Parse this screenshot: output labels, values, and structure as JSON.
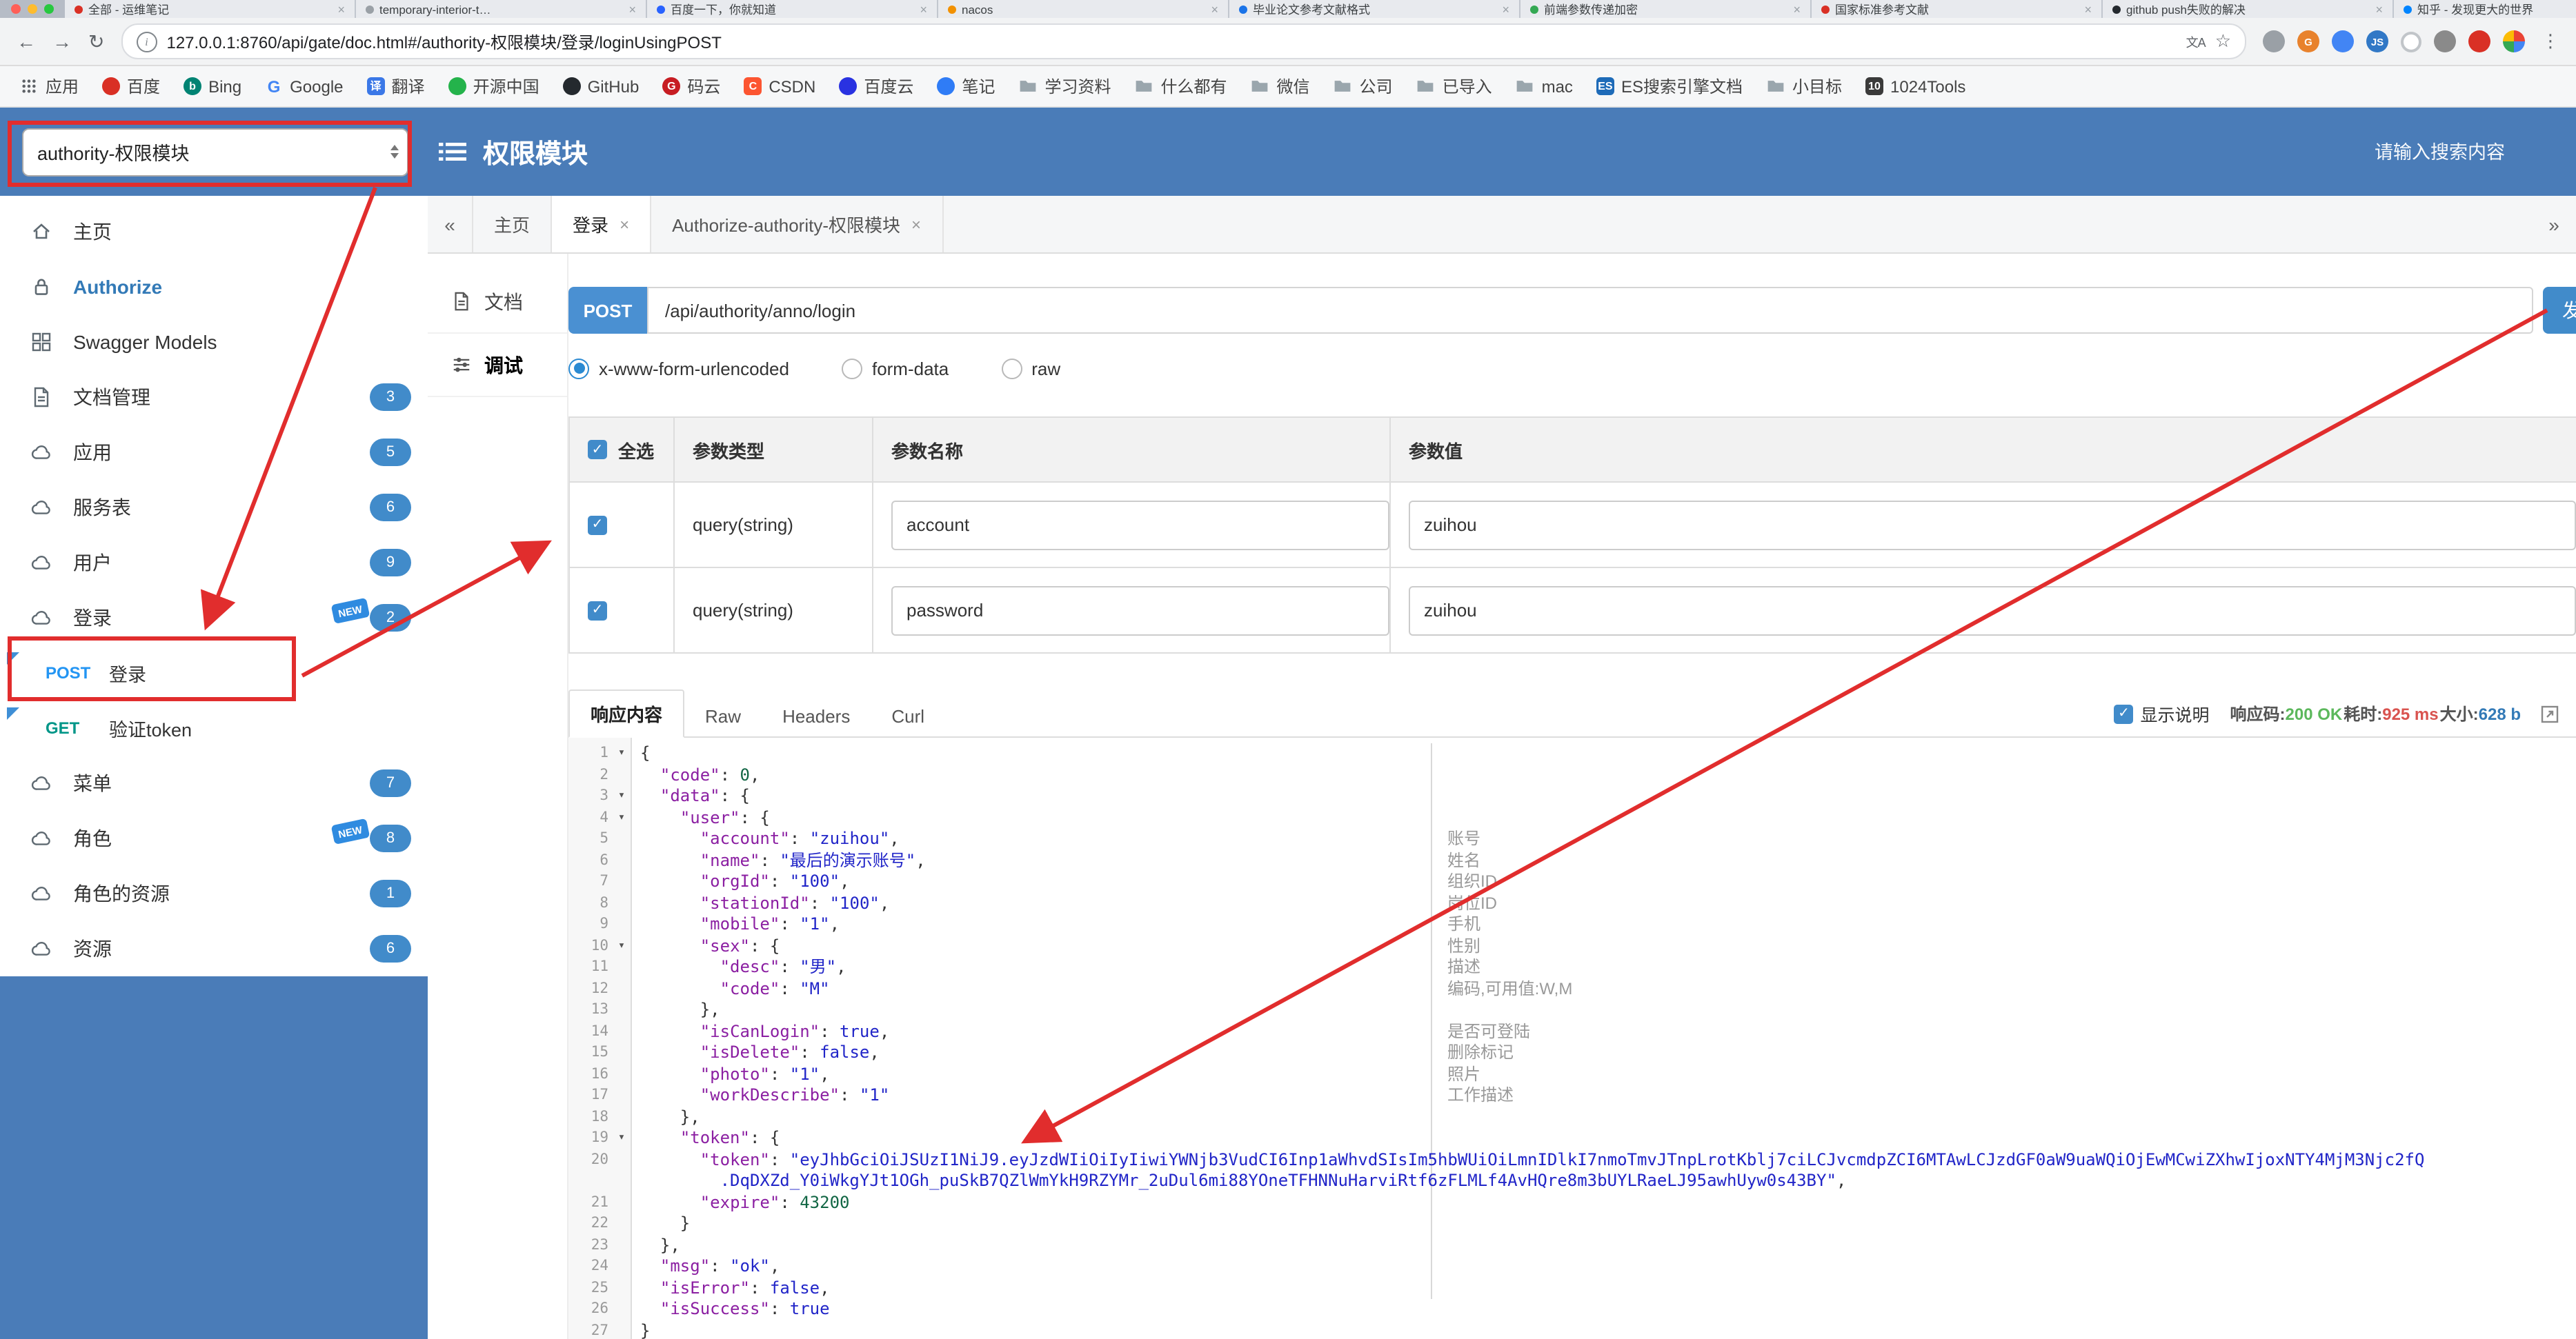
{
  "browser": {
    "close_glyph": "×",
    "star_glyph": "☆",
    "menu_glyph": "⋮",
    "translate_label": "文A",
    "nav": {
      "back": "←",
      "forward": "→",
      "reload": "↻"
    },
    "url": "127.0.0.1:8760/api/gate/doc.html#/authority-权限模块/登录/loginUsingPOST",
    "tabs": [
      {
        "title": "全部 - 运维笔记",
        "color": "#d93025"
      },
      {
        "title": "temporary-interior-t…",
        "color": "#9aa0a6"
      },
      {
        "title": "百度一下，你就知道",
        "color": "#2962ff"
      },
      {
        "title": "nacos",
        "color": "#f29100"
      },
      {
        "title": "毕业论文参考文献格式",
        "color": "#1a73e8"
      },
      {
        "title": "前端参数传递加密",
        "color": "#34a853"
      },
      {
        "title": "国家标准参考文献",
        "color": "#d93025"
      },
      {
        "title": "github push失败的解决",
        "color": "#24292e"
      },
      {
        "title": "知乎 - 发现更大的世界",
        "color": "#0084ff"
      }
    ],
    "ext_icons": [
      {
        "color": "#9aa0a6"
      },
      {
        "color": "#e8822d",
        "label": "G"
      },
      {
        "color": "#4285f4"
      },
      {
        "color": "#3178c6",
        "label": "JS"
      },
      {
        "color": "#f1f1f1",
        "ring": true
      },
      {
        "color": "#8a8a8a"
      },
      {
        "color": "#d93025"
      },
      {
        "color": "pinwheel"
      }
    ],
    "bookmarks": [
      {
        "label": "应用",
        "type": "grid"
      },
      {
        "label": "百度",
        "type": "dot",
        "color": "#d93025"
      },
      {
        "label": "Bing",
        "type": "dot",
        "color": "#008373",
        "letter": "b"
      },
      {
        "label": "Google",
        "type": "glyph",
        "color": "#4285f4",
        "letter": "G"
      },
      {
        "label": "翻译",
        "type": "square",
        "color": "#3b78e7",
        "letter": "译"
      },
      {
        "label": "开源中国",
        "type": "dot",
        "color": "#24b34b"
      },
      {
        "label": "GitHub",
        "type": "dot",
        "color": "#24292e"
      },
      {
        "label": "码云",
        "type": "dot",
        "color": "#c71d23",
        "letter": "G"
      },
      {
        "label": "CSDN",
        "type": "square",
        "color": "#fc5531",
        "letter": "C"
      },
      {
        "label": "百度云",
        "type": "dot",
        "color": "#2932e1"
      },
      {
        "label": "笔记",
        "type": "dot",
        "color": "#2f7cf6"
      },
      {
        "label": "学习资料",
        "type": "folder"
      },
      {
        "label": "什么都有",
        "type": "folder"
      },
      {
        "label": "微信",
        "type": "folder"
      },
      {
        "label": "公司",
        "type": "folder"
      },
      {
        "label": "已导入",
        "type": "folder"
      },
      {
        "label": "mac",
        "type": "folder"
      },
      {
        "label": "ES搜索引擎文档",
        "type": "square",
        "color": "#1e6bb8",
        "letter": "ES"
      },
      {
        "label": "小目标",
        "type": "folder"
      },
      {
        "label": "1024Tools",
        "type": "square",
        "color": "#3a3a3a",
        "letter": "10"
      }
    ]
  },
  "header": {
    "module_select": "authority-权限模块",
    "title": "权限模块",
    "search_placeholder": "请输入搜索内容"
  },
  "sidebar": {
    "new_label": "NEW",
    "items": [
      {
        "kind": "nav",
        "icon": "home",
        "label": "主页"
      },
      {
        "kind": "nav",
        "icon": "lock",
        "label": "Authorize",
        "active": true
      },
      {
        "kind": "nav",
        "icon": "models",
        "label": "Swagger Models"
      },
      {
        "kind": "nav",
        "icon": "doc",
        "label": "文档管理",
        "badge": "3"
      },
      {
        "kind": "nav",
        "icon": "cloud",
        "label": "应用",
        "badge": "5"
      },
      {
        "kind": "nav",
        "icon": "cloud",
        "label": "服务表",
        "badge": "6"
      },
      {
        "kind": "nav",
        "icon": "cloud",
        "label": "用户",
        "badge": "9"
      },
      {
        "kind": "nav",
        "icon": "cloud",
        "label": "登录",
        "badge": "2",
        "new": true
      },
      {
        "kind": "api",
        "method": "POST",
        "label": "登录",
        "marked": true
      },
      {
        "kind": "api",
        "method": "GET",
        "label": "验证token",
        "marked": true
      },
      {
        "kind": "nav",
        "icon": "cloud",
        "label": "菜单",
        "badge": "7"
      },
      {
        "kind": "nav",
        "icon": "cloud",
        "label": "角色",
        "badge": "8",
        "new": true
      },
      {
        "kind": "nav",
        "icon": "cloud",
        "label": "角色的资源",
        "badge": "1"
      },
      {
        "kind": "nav",
        "icon": "cloud",
        "label": "资源",
        "badge": "6"
      }
    ]
  },
  "doc_tabs": {
    "prev": "«",
    "next": "»",
    "close_glyph": "×",
    "tabs": [
      {
        "label": "主页",
        "closable": false
      },
      {
        "label": "登录",
        "closable": true,
        "active": true
      },
      {
        "label": "Authorize-authority-权限模块",
        "closable": true
      }
    ]
  },
  "rail": {
    "items": [
      {
        "label": "文档",
        "icon": "doc"
      },
      {
        "label": "调试",
        "icon": "debug",
        "active": true
      }
    ]
  },
  "request": {
    "method": "POST",
    "path": "/api/authority/anno/login",
    "send_label": "发送",
    "content_types": [
      {
        "label": "x-www-form-urlencoded",
        "selected": true
      },
      {
        "label": "form-data",
        "selected": false
      },
      {
        "label": "raw",
        "selected": false
      }
    ]
  },
  "params_table": {
    "headers": {
      "select": "全选",
      "type": "参数类型",
      "name": "参数名称",
      "value": "参数值"
    },
    "rows": [
      {
        "checked": true,
        "type": "query(string)",
        "name": "account",
        "value": "zuihou"
      },
      {
        "checked": true,
        "type": "query(string)",
        "name": "password",
        "value": "zuihou"
      }
    ]
  },
  "response": {
    "tabs": [
      {
        "label": "响应内容",
        "active": true
      },
      {
        "label": "Raw",
        "active": false
      },
      {
        "label": "Headers",
        "active": false
      },
      {
        "label": "Curl",
        "active": false
      }
    ],
    "show_desc": "显示说明",
    "show_desc_checked": true,
    "meta": [
      {
        "label": "响应码:",
        "value": "200 OK",
        "color": "#5cb85c"
      },
      {
        "label": "耗时:",
        "value": "925 ms",
        "color": "#d9534f"
      },
      {
        "label": "大小:",
        "value": "628 b",
        "color": "#337ab7"
      }
    ]
  },
  "editor": {
    "fold_glyph": "▾",
    "lines": [
      {
        "n": "1",
        "f": true,
        "t": [
          [
            "t",
            "{"
          ]
        ]
      },
      {
        "n": "2",
        "t": [
          [
            "t",
            "  "
          ],
          [
            "k",
            "\"code\""
          ],
          [
            "t",
            ": "
          ],
          [
            "n",
            "0"
          ],
          [
            "t",
            ","
          ]
        ]
      },
      {
        "n": "3",
        "f": true,
        "t": [
          [
            "t",
            "  "
          ],
          [
            "k",
            "\"data\""
          ],
          [
            "t",
            ": {"
          ]
        ]
      },
      {
        "n": "4",
        "f": true,
        "t": [
          [
            "t",
            "    "
          ],
          [
            "k",
            "\"user\""
          ],
          [
            "t",
            ": {"
          ]
        ]
      },
      {
        "n": "5",
        "t": [
          [
            "t",
            "      "
          ],
          [
            "k",
            "\"account\""
          ],
          [
            "t",
            ": "
          ],
          [
            "s",
            "\"zuihou\""
          ],
          [
            "t",
            ","
          ]
        ]
      },
      {
        "n": "6",
        "t": [
          [
            "t",
            "      "
          ],
          [
            "k",
            "\"name\""
          ],
          [
            "t",
            ": "
          ],
          [
            "s",
            "\"最后的演示账号\""
          ],
          [
            "t",
            ","
          ]
        ]
      },
      {
        "n": "7",
        "t": [
          [
            "t",
            "      "
          ],
          [
            "k",
            "\"orgId\""
          ],
          [
            "t",
            ": "
          ],
          [
            "s",
            "\"100\""
          ],
          [
            "t",
            ","
          ]
        ]
      },
      {
        "n": "8",
        "t": [
          [
            "t",
            "      "
          ],
          [
            "k",
            "\"stationId\""
          ],
          [
            "t",
            ": "
          ],
          [
            "s",
            "\"100\""
          ],
          [
            "t",
            ","
          ]
        ]
      },
      {
        "n": "9",
        "t": [
          [
            "t",
            "      "
          ],
          [
            "k",
            "\"mobile\""
          ],
          [
            "t",
            ": "
          ],
          [
            "s",
            "\"1\""
          ],
          [
            "t",
            ","
          ]
        ]
      },
      {
        "n": "10",
        "f": true,
        "t": [
          [
            "t",
            "      "
          ],
          [
            "k",
            "\"sex\""
          ],
          [
            "t",
            ": {"
          ]
        ]
      },
      {
        "n": "11",
        "t": [
          [
            "t",
            "        "
          ],
          [
            "k",
            "\"desc\""
          ],
          [
            "t",
            ": "
          ],
          [
            "s",
            "\"男\""
          ],
          [
            "t",
            ","
          ]
        ]
      },
      {
        "n": "12",
        "t": [
          [
            "t",
            "        "
          ],
          [
            "k",
            "\"code\""
          ],
          [
            "t",
            ": "
          ],
          [
            "s",
            "\"M\""
          ]
        ]
      },
      {
        "n": "13",
        "t": [
          [
            "t",
            "      },"
          ]
        ]
      },
      {
        "n": "14",
        "t": [
          [
            "t",
            "      "
          ],
          [
            "k",
            "\"isCanLogin\""
          ],
          [
            "t",
            ": "
          ],
          [
            "b",
            "true"
          ],
          [
            "t",
            ","
          ]
        ]
      },
      {
        "n": "15",
        "t": [
          [
            "t",
            "      "
          ],
          [
            "k",
            "\"isDelete\""
          ],
          [
            "t",
            ": "
          ],
          [
            "b",
            "false"
          ],
          [
            "t",
            ","
          ]
        ]
      },
      {
        "n": "16",
        "t": [
          [
            "t",
            "      "
          ],
          [
            "k",
            "\"photo\""
          ],
          [
            "t",
            ": "
          ],
          [
            "s",
            "\"1\""
          ],
          [
            "t",
            ","
          ]
        ]
      },
      {
        "n": "17",
        "t": [
          [
            "t",
            "      "
          ],
          [
            "k",
            "\"workDescribe\""
          ],
          [
            "t",
            ": "
          ],
          [
            "s",
            "\"1\""
          ]
        ]
      },
      {
        "n": "18",
        "t": [
          [
            "t",
            "    },"
          ]
        ]
      },
      {
        "n": "19",
        "f": true,
        "t": [
          [
            "t",
            "    "
          ],
          [
            "k",
            "\"token\""
          ],
          [
            "t",
            ": {"
          ]
        ]
      },
      {
        "n": "20",
        "t": [
          [
            "t",
            "      "
          ],
          [
            "k",
            "\"token\""
          ],
          [
            "t",
            ": "
          ],
          [
            "s",
            "\"eyJhbGciOiJSUzI1NiJ9.eyJzdWIiOiIyIiwiYWNjb3VudCI6Inp1aWhvdSIsIm5hbWUiOiLmnIDlkI7nmoTmvJTnpLrotKblj7ciLCJvcmdpZCI6MTAwLCJzdGF0aW9uaWQiOjEwMCwiZXhwIjoxNTY4MjM3Njc2fQ"
          ]
        ]
      },
      {
        "n": "",
        "t": [
          [
            "t",
            "        "
          ],
          [
            "s",
            ".DqDXZd_Y0iWkgYJt1OGh_puSkB7QZlWmYkH9RZYMr_2uDul6mi88YOneTFHNNuHarviRtf6zFLMLf4AvHQre8m3bUYLRaeLJ95awhUyw0s43BY\""
          ],
          [
            "t",
            ","
          ]
        ]
      },
      {
        "n": "21",
        "t": [
          [
            "t",
            "      "
          ],
          [
            "k",
            "\"expire\""
          ],
          [
            "t",
            ": "
          ],
          [
            "n",
            "43200"
          ]
        ]
      },
      {
        "n": "22",
        "t": [
          [
            "t",
            "    }"
          ]
        ]
      },
      {
        "n": "23",
        "t": [
          [
            "t",
            "  },"
          ]
        ]
      },
      {
        "n": "24",
        "t": [
          [
            "t",
            "  "
          ],
          [
            "k",
            "\"msg\""
          ],
          [
            "t",
            ": "
          ],
          [
            "s",
            "\"ok\""
          ],
          [
            "t",
            ","
          ]
        ]
      },
      {
        "n": "25",
        "t": [
          [
            "t",
            "  "
          ],
          [
            "k",
            "\"isError\""
          ],
          [
            "t",
            ": "
          ],
          [
            "b",
            "false"
          ],
          [
            "t",
            ","
          ]
        ]
      },
      {
        "n": "26",
        "t": [
          [
            "t",
            "  "
          ],
          [
            "k",
            "\"isSuccess\""
          ],
          [
            "t",
            ": "
          ],
          [
            "b",
            "true"
          ]
        ]
      },
      {
        "n": "27",
        "t": [
          [
            "t",
            "}"
          ]
        ]
      }
    ],
    "comments": [
      {
        "line": 5,
        "text": "账号"
      },
      {
        "line": 6,
        "text": "姓名"
      },
      {
        "line": 7,
        "text": "组织ID"
      },
      {
        "line": 8,
        "text": "岗位ID"
      },
      {
        "line": 9,
        "text": "手机"
      },
      {
        "line": 10,
        "text": "性别"
      },
      {
        "line": 11,
        "text": "描述"
      },
      {
        "line": 12,
        "text": "编码,可用值:W,M"
      },
      {
        "line": 14,
        "text": "是否可登陆"
      },
      {
        "line": 15,
        "text": "删除标记"
      },
      {
        "line": 16,
        "text": "照片"
      },
      {
        "line": 17,
        "text": "工作描述"
      }
    ]
  }
}
